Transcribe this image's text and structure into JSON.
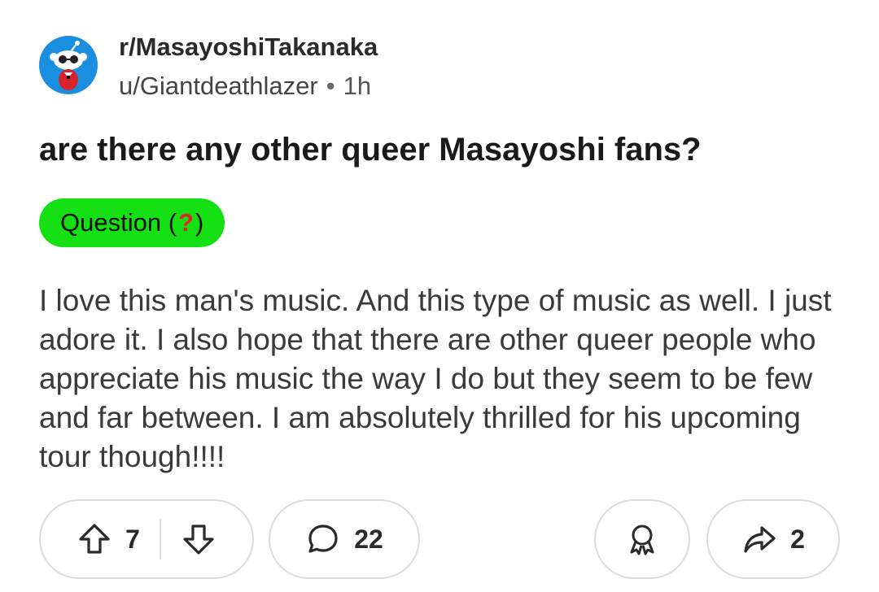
{
  "post": {
    "subreddit": "r/MasayoshiTakanaka",
    "author": "u/Giantdeathlazer",
    "separator": "•",
    "age": "1h",
    "title": "are there any other queer Masayoshi fans?",
    "flair": {
      "prefix": "Question (",
      "emoji": "?",
      "suffix": ")",
      "color": "#14e014"
    },
    "body": "I love this man's music. And this type of music as well. I just adore it. I also hope that there are other queer people who appreciate his music the way I do but they seem to be few and far between. I am absolutely thrilled for his upcoming tour though!!!!"
  },
  "actions": {
    "upvote_icon": "upvote-arrow-icon",
    "vote_count": "7",
    "downvote_icon": "downvote-arrow-icon",
    "comment_icon": "comment-bubble-icon",
    "comment_count": "22",
    "award_icon": "award-ribbon-icon",
    "share_icon": "share-arrow-icon",
    "share_count": "2"
  },
  "colors": {
    "flair_bg": "#14e014",
    "avatar_bg": "#1a8fe0",
    "text": "#1a1a1a"
  }
}
